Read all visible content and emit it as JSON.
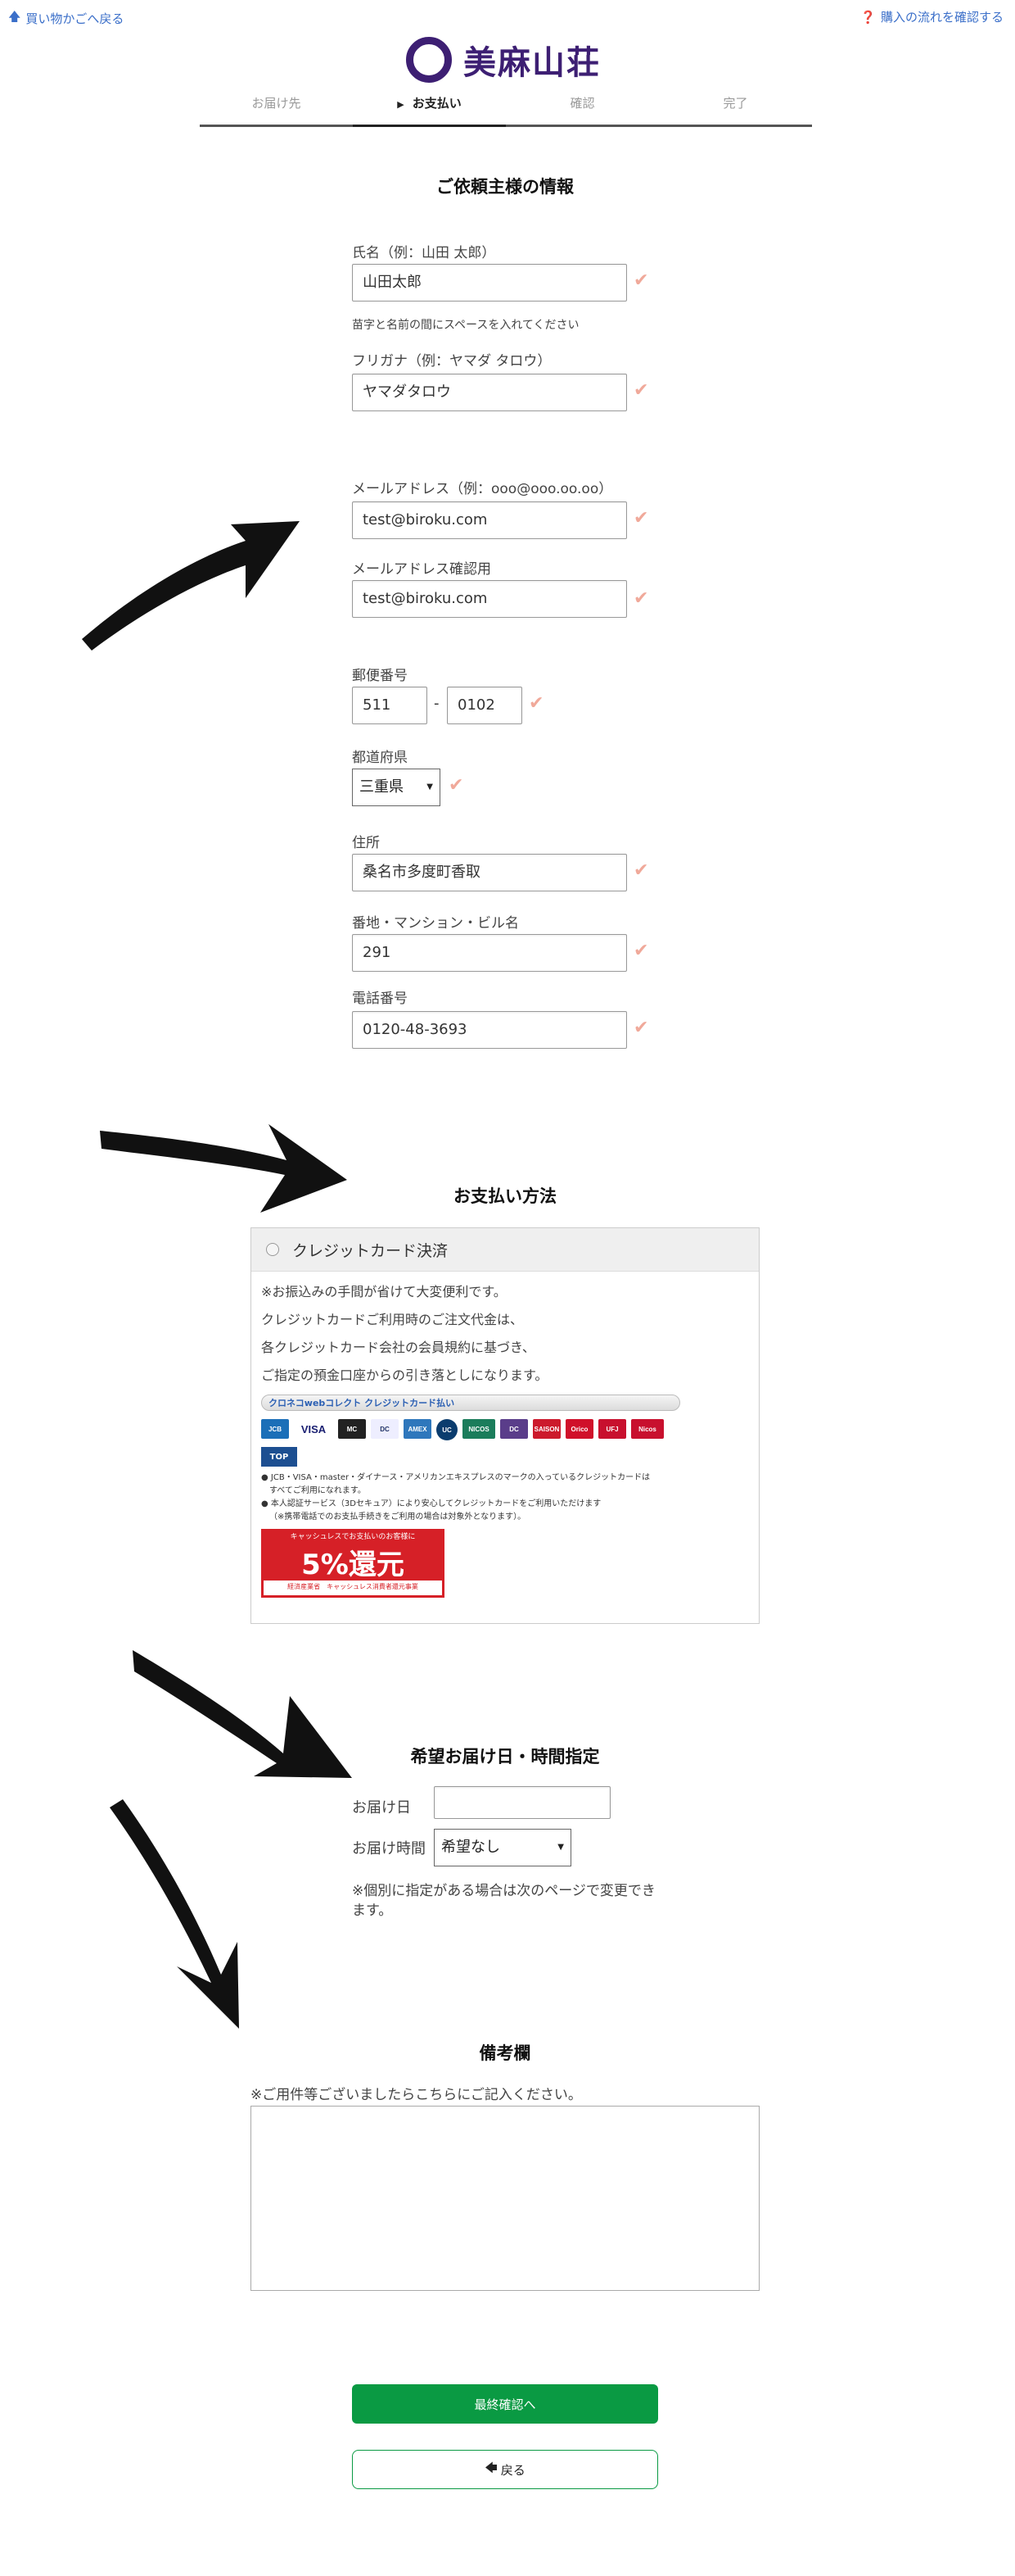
{
  "top": {
    "back_link": "買い物かごへ戻る",
    "flow_link": "購入の流れを確認する"
  },
  "logo": {
    "text": "美麻山荘"
  },
  "steps": [
    {
      "label": "お届け先"
    },
    {
      "label": "お支払い"
    },
    {
      "label": "確認"
    },
    {
      "label": "完了"
    }
  ],
  "requester": {
    "heading": "ご依頼主様の情報",
    "name_label": "氏名（例：山田 太郎）",
    "name_value": "山田太郎",
    "name_note": "苗字と名前の間にスペースを入れてください",
    "kana_label": "フリガナ（例：ヤマダ タロウ）",
    "kana_value": "ヤマダタロウ",
    "email_label": "メールアドレス（例：ooo@ooo.oo.oo）",
    "email_value": "test@biroku.com",
    "email_confirm_label": "メールアドレス確認用",
    "email_confirm_value": "test@biroku.com",
    "zip_label": "郵便番号",
    "zip1": "511",
    "zip_sep": "-",
    "zip2": "0102",
    "pref_label": "都道府県",
    "pref_value": "三重県",
    "addr_label": "住所",
    "addr_value": "桑名市多度町香取",
    "bldg_label": "番地・マンション・ビル名",
    "bldg_value": "291",
    "tel_label": "電話番号",
    "tel_value": "0120-48-3693",
    "check_mark": "✔"
  },
  "payment": {
    "heading": "お支払い方法",
    "option_label": "クレジットカード決済",
    "lines": [
      "※お振込みの手間が省けて大変便利です。",
      "クレジットカードご利用時のご注文代金は、",
      "各クレジットカード会社の会員規約に基づき、",
      "ご指定の預金口座からの引き落としになります。"
    ],
    "kuroneko_label": "クロネコwebコレクト クレジットカード払い",
    "card_brands": [
      "JCB",
      "VISA",
      "MC",
      "DC",
      "AMEX",
      "UC",
      "NICOS",
      "DC",
      "SAISON",
      "Orico",
      "UFJ",
      "Nicos"
    ],
    "top_badge": "TOP",
    "fine1": "● JCB・VISA・master・ダイナース・アメリカンエキスプレスのマークの入っているクレジットカードは",
    "fine1b": "すべてご利用になれます。",
    "fine2": "● 本人認証サービス（3Dセキュア）により安心してクレジットカードをご利用いただけます",
    "fine2b": "（※携帯電話でのお支払手続きをご利用の場合は対象外となります）。",
    "cashless_top": "キャッシュレスでお支払いのお客様に",
    "cashless_main": "5%還元",
    "cashless_bottom": "経済産業省　キャッシュレス消費者還元事業"
  },
  "delivery": {
    "heading": "希望お届け日・時間指定",
    "date_label": "お届け日",
    "date_value": "",
    "time_label": "お届け時間",
    "time_value": "希望なし",
    "note": "※個別に指定がある場合は次のページで変更できます。"
  },
  "remarks": {
    "heading": "備考欄",
    "note": "※ご用件等ございましたらこちらにご記入ください。",
    "value": ""
  },
  "buttons": {
    "confirm": "最終確認へ",
    "back": "戻る"
  },
  "colors": {
    "brand": "#3d1f73",
    "link": "#3b6fc9",
    "check": "#f0a99a",
    "primary": "#0a9a43"
  }
}
